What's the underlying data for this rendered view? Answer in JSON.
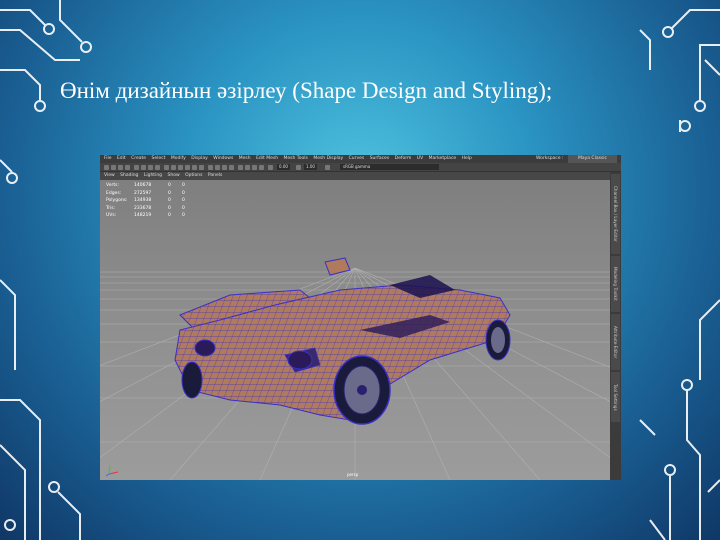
{
  "slide": {
    "title": "Өнім дизайнын әзірлеу (Shape Design and Styling);"
  },
  "app": {
    "menu": [
      "File",
      "Edit",
      "Create",
      "Select",
      "Modify",
      "Display",
      "Windows",
      "Mesh",
      "Edit Mesh",
      "Mesh Tools",
      "Mesh Display",
      "Curves",
      "Surfaces",
      "Deform",
      "UV",
      "Marketplace",
      "Help"
    ],
    "workspace_label": "Workspace :",
    "workspace_value": "Maya Classic",
    "toolbar": {
      "value1": "0.00",
      "value2": "1.00",
      "color_space": "sRGB gamma"
    },
    "panel_menu": [
      "View",
      "Shading",
      "Lighting",
      "Show",
      "Options",
      "Panels"
    ],
    "hud": [
      {
        "label": "Verts:",
        "value": "140678",
        "a": "0",
        "b": "0"
      },
      {
        "label": "Edges:",
        "value": "272597",
        "a": "0",
        "b": "0"
      },
      {
        "label": "Polygons:",
        "value": "134938",
        "a": "0",
        "b": "0"
      },
      {
        "label": "Tris:",
        "value": "233678",
        "a": "0",
        "b": "0"
      },
      {
        "label": "UVs:",
        "value": "148219",
        "a": "0",
        "b": "0"
      }
    ],
    "camera_label": "persp",
    "side_tabs": [
      "Channel Box / Layer Editor",
      "Modeling Toolkit",
      "Attribute Editor",
      "Tool Settings"
    ]
  },
  "colors": {
    "background_center": "#4fc3df",
    "background_edge": "#0f3766",
    "circuit_lines": "#ffffff",
    "car_fill": "#b07a5c",
    "car_wire": "#4a3ed8",
    "viewport": "#8a8a8a"
  }
}
